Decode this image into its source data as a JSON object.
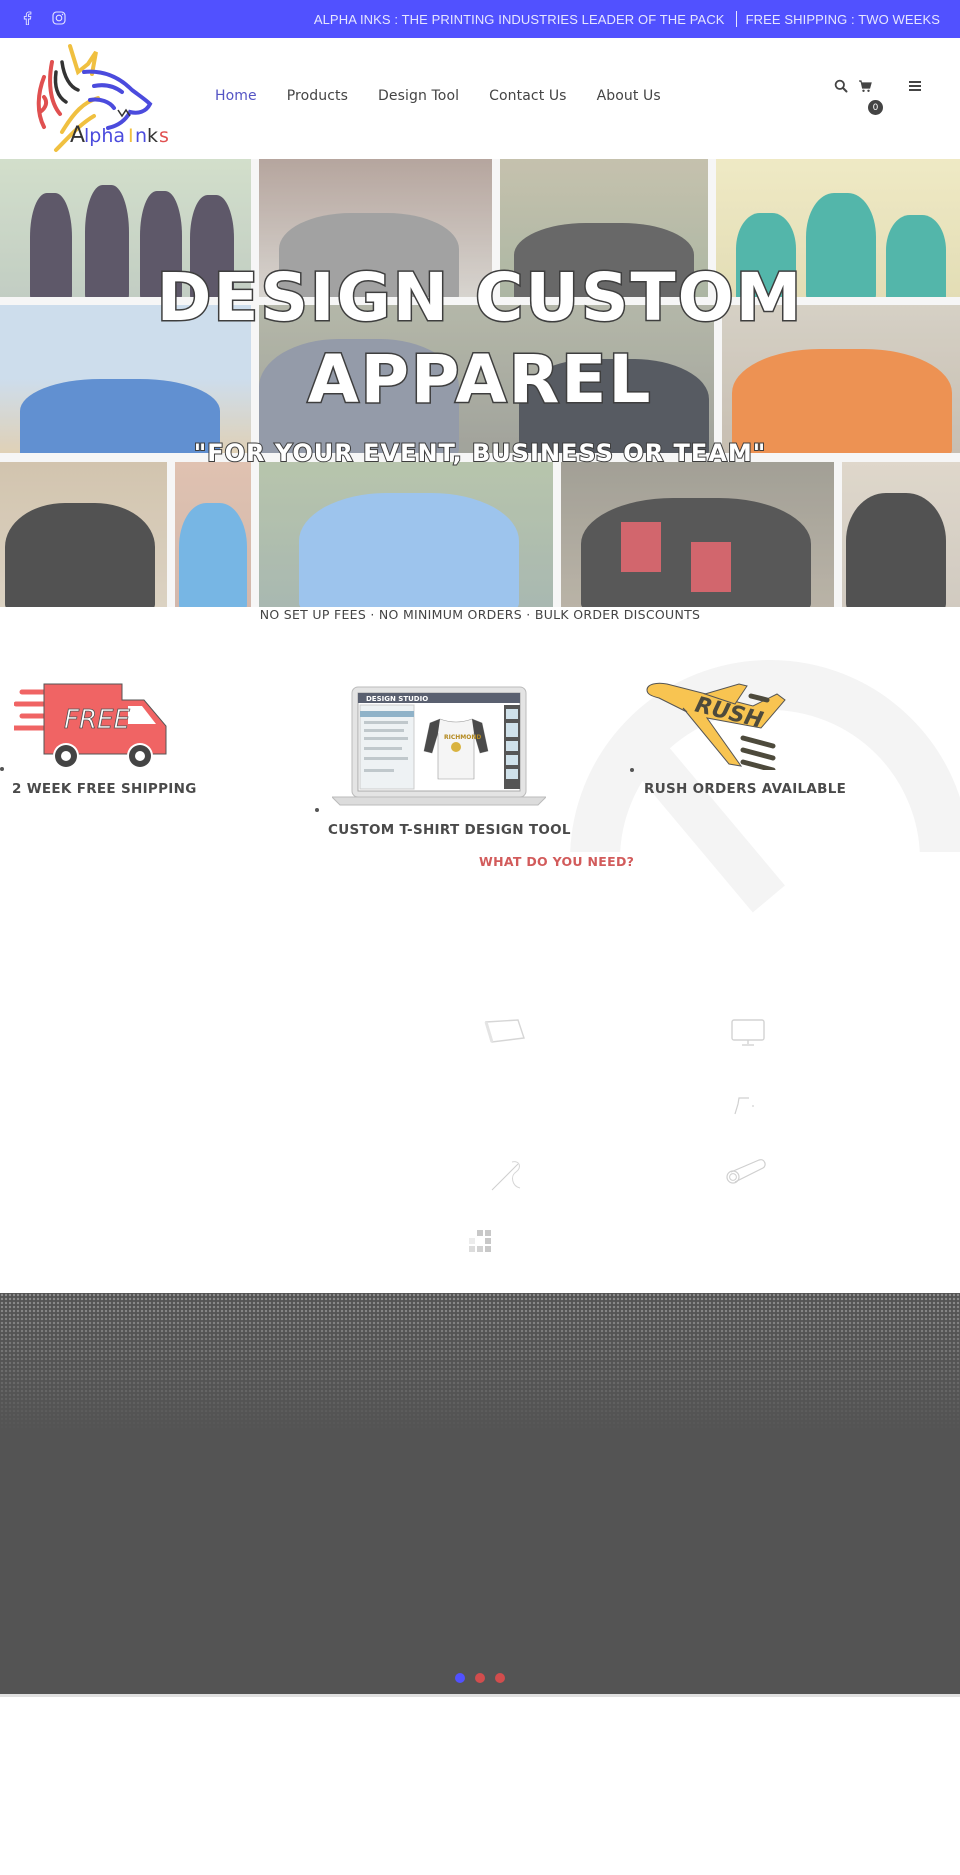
{
  "topbar": {
    "social": [
      {
        "icon": "facebook-icon"
      },
      {
        "icon": "instagram-icon"
      }
    ],
    "tagline_left": "ALPHA INKS : THE PRINTING INDUSTRIES LEADER OF THE PACK",
    "tagline_right": "FREE SHIPPING : TWO WEEKS",
    "bg_color": "#5151ff"
  },
  "header": {
    "logo_text": "Alpha Inks",
    "nav": [
      {
        "label": "Home",
        "active": true
      },
      {
        "label": "Products",
        "active": false
      },
      {
        "label": "Design Tool",
        "active": false
      },
      {
        "label": "Contact Us",
        "active": false
      },
      {
        "label": "About Us",
        "active": false
      }
    ],
    "icons": [
      "search-icon",
      "cart-icon",
      "menu-icon"
    ],
    "cart_count": "0",
    "active_color": "#5353c4"
  },
  "hero": {
    "title_line1": "DESIGN CUSTOM",
    "title_line2": "APPAREL",
    "subtitle": "\"FOR YOUR EVENT, BUSINESS OR TEAM\""
  },
  "usp_line": "NO SET UP FEES · NO MINIMUM ORDERS · BULK ORDER DISCOUNTS",
  "features": [
    {
      "label": "2 WEEK FREE SHIPPING",
      "image_text": "FREE",
      "icon": "free-shipping-truck-icon"
    },
    {
      "label": "CUSTOM T-SHIRT DESIGN TOOL",
      "image_text": "DESIGN STUDIO",
      "icon": "design-studio-laptop-icon"
    },
    {
      "label": "RUSH ORDERS AVAILABLE",
      "image_text": "RUSH",
      "icon": "rush-plane-icon"
    }
  ],
  "what_do_you_need": "WHAT DO YOU NEED?",
  "service_icons": [
    "tablet-icon",
    "monitor-icon",
    "corner-icon",
    "needle-thread-icon",
    "roll-icon",
    "pixel-grid-icon"
  ],
  "slider": {
    "dots": [
      {
        "active": true,
        "color": "#5151ff"
      },
      {
        "active": false,
        "color": "#d24d4d"
      },
      {
        "active": false,
        "color": "#d24d4d"
      }
    ]
  }
}
